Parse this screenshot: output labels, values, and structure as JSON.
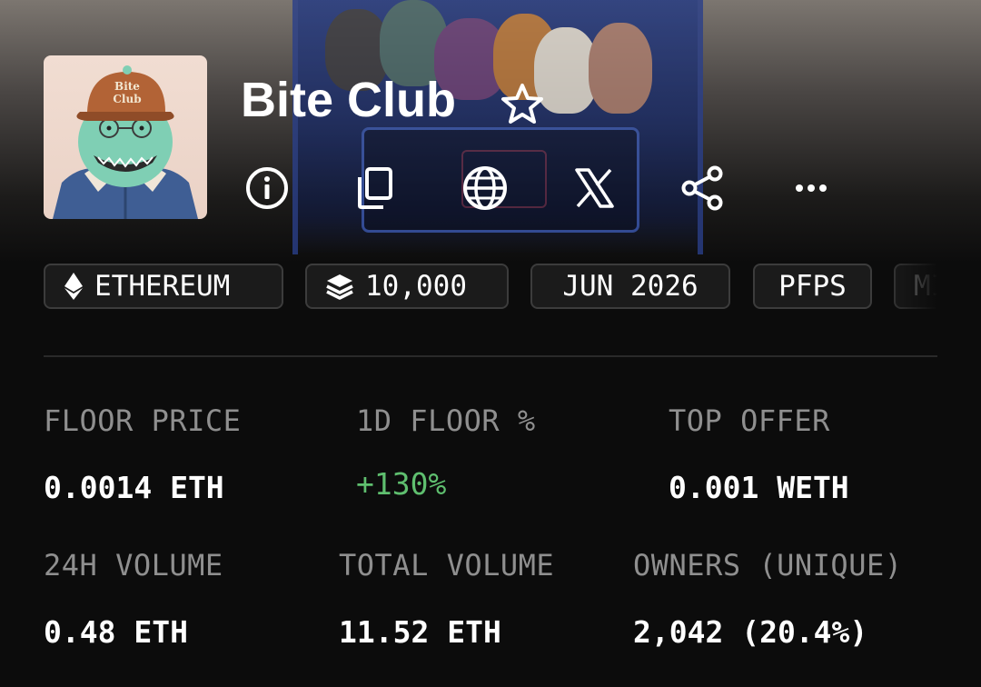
{
  "collection": {
    "name": "Bite Club",
    "avatar_hat_text": "Bite Club"
  },
  "actions": [
    {
      "icon": "info-icon"
    },
    {
      "icon": "copy-icon"
    },
    {
      "icon": "globe-icon"
    },
    {
      "icon": "x-logo-icon"
    },
    {
      "icon": "share-icon"
    },
    {
      "icon": "more-icon"
    }
  ],
  "tags": {
    "chain": "ETHEREUM",
    "items": "10,000",
    "date": "JUN 2026",
    "category": "PFPS",
    "partial": "MI"
  },
  "stats": {
    "floor_price": {
      "label": "FLOOR PRICE",
      "value": "0.0014 ETH"
    },
    "floor_change": {
      "label": "1D FLOOR %",
      "value": "+130%"
    },
    "top_offer": {
      "label": "TOP OFFER",
      "value": "0.001 WETH"
    },
    "volume_24h": {
      "label": "24H VOLUME",
      "value": "0.48 ETH"
    },
    "total_volume": {
      "label": "TOTAL VOLUME",
      "value": "11.52 ETH"
    },
    "owners": {
      "label": "OWNERS (UNIQUE)",
      "value": "2,042 (20.4%)"
    }
  },
  "colors": {
    "positive": "#5fbf6f",
    "label": "#8f8f8f",
    "chip_border": "#3c3c3c"
  }
}
